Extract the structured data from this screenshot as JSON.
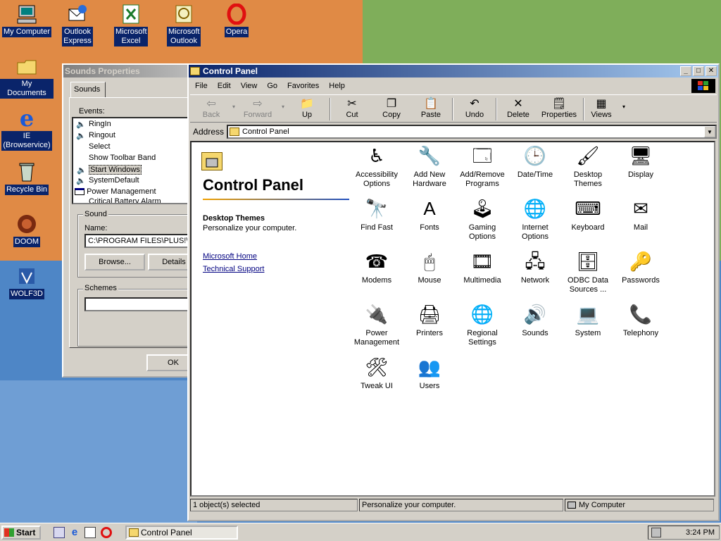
{
  "desktop": {
    "icons": [
      {
        "label": "My Computer"
      },
      {
        "label": "Outlook Express"
      },
      {
        "label": "Microsoft Excel"
      },
      {
        "label": "Microsoft Outlook"
      },
      {
        "label": "Opera"
      },
      {
        "label": "My Documents"
      },
      {
        "label": "IE (Browservice)"
      },
      {
        "label": "Recycle Bin"
      },
      {
        "label": "DOOM"
      },
      {
        "label": "WOLF3D"
      }
    ]
  },
  "sounds_window": {
    "title": "Sounds Properties",
    "tab": "Sounds",
    "events_label": "Events:",
    "events": [
      "RingIn",
      "Ringout",
      "Select",
      "Show Toolbar Band",
      "Start Windows",
      "SystemDefault",
      "Power Management",
      "Critical Battery Alarm"
    ],
    "sound_group": "Sound",
    "name_label": "Name:",
    "name_value": "C:\\PROGRAM FILES\\PLUS!\\",
    "browse_button": "Browse...",
    "details_button": "Details",
    "schemes_group": "Schemes",
    "ok_button": "OK"
  },
  "cp_window": {
    "title": "Control Panel",
    "menu": [
      "File",
      "Edit",
      "View",
      "Go",
      "Favorites",
      "Help"
    ],
    "toolbar": {
      "back": "Back",
      "forward": "Forward",
      "up": "Up",
      "cut": "Cut",
      "copy": "Copy",
      "paste": "Paste",
      "undo": "Undo",
      "delete": "Delete",
      "properties": "Properties",
      "views": "Views"
    },
    "address_label": "Address",
    "address_value": "Control Panel",
    "left": {
      "heading": "Control Panel",
      "selected_name": "Desktop Themes",
      "selected_desc": "Personalize your computer.",
      "link1": "Microsoft Home",
      "link2": "Technical Support"
    },
    "items": [
      {
        "l1": "Accessibility",
        "l2": "Options",
        "icon": "accessibility-icon"
      },
      {
        "l1": "Add New",
        "l2": "Hardware",
        "icon": "hardware-icon"
      },
      {
        "l1": "Add/Remove",
        "l2": "Programs",
        "icon": "programs-icon"
      },
      {
        "l1": "Date/Time",
        "l2": "",
        "icon": "clock-icon"
      },
      {
        "l1": "Desktop",
        "l2": "Themes",
        "icon": "themes-icon"
      },
      {
        "l1": "Display",
        "l2": "",
        "icon": "display-icon"
      },
      {
        "l1": "Find Fast",
        "l2": "",
        "icon": "binoculars-icon"
      },
      {
        "l1": "Fonts",
        "l2": "",
        "icon": "fonts-icon"
      },
      {
        "l1": "Gaming",
        "l2": "Options",
        "icon": "joystick-icon"
      },
      {
        "l1": "Internet",
        "l2": "Options",
        "icon": "globe-icon"
      },
      {
        "l1": "Keyboard",
        "l2": "",
        "icon": "keyboard-icon"
      },
      {
        "l1": "Mail",
        "l2": "",
        "icon": "mail-icon"
      },
      {
        "l1": "Modems",
        "l2": "",
        "icon": "modem-icon"
      },
      {
        "l1": "Mouse",
        "l2": "",
        "icon": "mouse-icon"
      },
      {
        "l1": "Multimedia",
        "l2": "",
        "icon": "multimedia-icon"
      },
      {
        "l1": "Network",
        "l2": "",
        "icon": "network-icon"
      },
      {
        "l1": "ODBC Data",
        "l2": "Sources ...",
        "icon": "database-icon"
      },
      {
        "l1": "Passwords",
        "l2": "",
        "icon": "keys-icon"
      },
      {
        "l1": "Power",
        "l2": "Management",
        "icon": "power-icon"
      },
      {
        "l1": "Printers",
        "l2": "",
        "icon": "printer-icon"
      },
      {
        "l1": "Regional",
        "l2": "Settings",
        "icon": "globe-icon"
      },
      {
        "l1": "Sounds",
        "l2": "",
        "icon": "speaker-icon"
      },
      {
        "l1": "System",
        "l2": "",
        "icon": "computer-icon"
      },
      {
        "l1": "Telephony",
        "l2": "",
        "icon": "telephone-icon"
      },
      {
        "l1": "Tweak UI",
        "l2": "",
        "icon": "tweakui-icon"
      },
      {
        "l1": "Users",
        "l2": "",
        "icon": "users-icon"
      }
    ],
    "status": {
      "selected": "1 object(s) selected",
      "desc": "Personalize your computer.",
      "zone": "My Computer"
    }
  },
  "taskbar": {
    "start": "Start",
    "task": "Control Panel",
    "clock": "3:24 PM"
  }
}
